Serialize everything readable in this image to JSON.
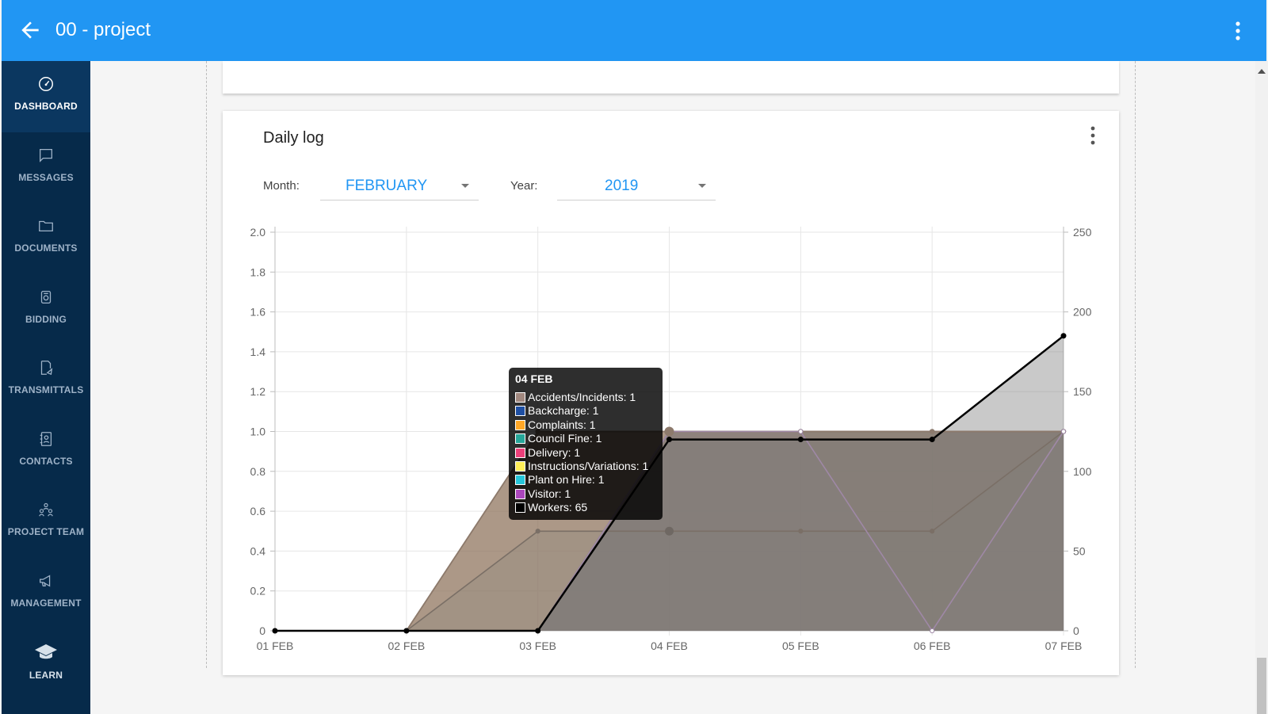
{
  "app": {
    "title": "00 - project"
  },
  "sidebar": {
    "items": [
      {
        "label": "DASHBOARD",
        "icon": "dashboard-icon",
        "active": true
      },
      {
        "label": "MESSAGES",
        "icon": "message-icon"
      },
      {
        "label": "DOCUMENTS",
        "icon": "folder-icon"
      },
      {
        "label": "BIDDING",
        "icon": "bidding-icon"
      },
      {
        "label": "TRANSMITTALS",
        "icon": "transmittal-icon"
      },
      {
        "label": "CONTACTS",
        "icon": "contacts-icon"
      },
      {
        "label": "PROJECT TEAM",
        "icon": "team-icon"
      },
      {
        "label": "MANAGEMENT",
        "icon": "megaphone-icon"
      },
      {
        "label": "LEARN",
        "icon": "graduation-cap-icon"
      }
    ]
  },
  "daily_log": {
    "title": "Daily log",
    "month_label": "Month:",
    "month_value": "FEBRUARY",
    "year_label": "Year:",
    "year_value": "2019"
  },
  "colors": {
    "appbar": "#2196f3",
    "sidebar": "#062a4a",
    "accidents": "#a1887f",
    "backcharge": "#1e4fa3",
    "complaints": "#ffa726",
    "council_fine": "#26a69a",
    "delivery": "#ec407a",
    "instructions": "#ffee58",
    "plant_on_hire": "#26c6da",
    "visitor": "#ab47bc",
    "workers": "#000000"
  },
  "chart_data": {
    "type": "area",
    "categories": [
      "01 FEB",
      "02 FEB",
      "03 FEB",
      "04 FEB",
      "05 FEB",
      "06 FEB",
      "07 FEB"
    ],
    "y_left": {
      "ticks": [
        "0",
        "0.2",
        "0.4",
        "0.6",
        "0.8",
        "1.0",
        "1.2",
        "1.4",
        "1.6",
        "1.8",
        "2.0"
      ],
      "ylim": [
        0,
        2.0
      ]
    },
    "y_right": {
      "ticks": [
        "0",
        "50",
        "100",
        "150",
        "200",
        "250"
      ],
      "ylim": [
        0,
        250
      ]
    },
    "series": [
      {
        "name": "Accidents/Incidents",
        "color": "#a1887f",
        "axis": "left",
        "values": [
          0,
          0,
          1,
          1,
          1,
          1,
          1
        ]
      },
      {
        "name": "Backcharge",
        "color": "#1e4fa3",
        "axis": "left",
        "values": [
          0,
          0,
          0,
          1,
          1,
          1,
          1
        ]
      },
      {
        "name": "Complaints",
        "color": "#ffa726",
        "axis": "left",
        "values": [
          0,
          0,
          1,
          1,
          1,
          1,
          1
        ]
      },
      {
        "name": "Council Fine",
        "color": "#26a69a",
        "axis": "left",
        "values": [
          0,
          0,
          1,
          1,
          1,
          1,
          1
        ]
      },
      {
        "name": "Delivery",
        "color": "#ec407a",
        "axis": "left",
        "values": [
          0,
          0,
          0,
          1,
          1,
          1,
          1
        ]
      },
      {
        "name": "Instructions/Variations",
        "color": "#ffee58",
        "axis": "left",
        "values": [
          0,
          0,
          0,
          1,
          1,
          1,
          1
        ]
      },
      {
        "name": "Plant on Hire",
        "color": "#26c6da",
        "axis": "left",
        "values": [
          0,
          0,
          0.5,
          0.5,
          0.5,
          0.5,
          1
        ]
      },
      {
        "name": "Visitor",
        "color": "#ab47bc",
        "axis": "left",
        "values": [
          0,
          0,
          0,
          1,
          1,
          0,
          1
        ]
      },
      {
        "name": "Workers",
        "color": "#000000",
        "axis": "right",
        "values": [
          0,
          0,
          0,
          120,
          120,
          120,
          185
        ]
      }
    ],
    "tooltip": {
      "title": "04 FEB",
      "rows": [
        {
          "color": "#a1887f",
          "text": "Accidents/Incidents: 1"
        },
        {
          "color": "#1e4fa3",
          "text": "Backcharge: 1"
        },
        {
          "color": "#ffa726",
          "text": "Complaints: 1"
        },
        {
          "color": "#26a69a",
          "text": "Council Fine: 1"
        },
        {
          "color": "#ec407a",
          "text": "Delivery: 1"
        },
        {
          "color": "#ffee58",
          "text": "Instructions/Variations: 1"
        },
        {
          "color": "#26c6da",
          "text": "Plant on Hire: 1"
        },
        {
          "color": "#ab47bc",
          "text": "Visitor: 1"
        },
        {
          "color": "#000000",
          "text": "Workers: 65"
        }
      ]
    }
  }
}
